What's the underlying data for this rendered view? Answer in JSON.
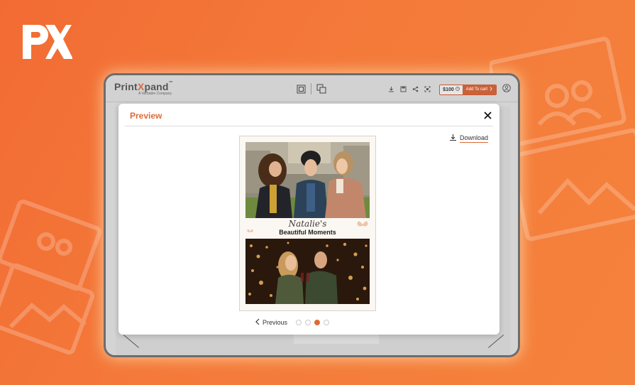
{
  "brand": {
    "logo_text": "PX",
    "accent": "#f47a3a"
  },
  "app": {
    "name_prefix": "Print",
    "name_accent": "X",
    "name_suffix": "pand",
    "trademark": "™",
    "tagline": "A Verbatim Company",
    "price": "$100",
    "add_to_cart": "Add To cart"
  },
  "modal": {
    "title": "Preview",
    "download_label": "Download",
    "caption_script": "Natalie's",
    "caption_main": "Beautiful Moments",
    "prev_label": "Previous",
    "pages": [
      {
        "state": "inactive"
      },
      {
        "state": "inactive"
      },
      {
        "state": "active"
      },
      {
        "state": "inactive"
      }
    ]
  },
  "icons": [
    "px-logo",
    "layers-icon",
    "duplicate-icon",
    "download-icon",
    "save-icon",
    "share-icon",
    "fullscreen-icon",
    "clock-icon",
    "chevron-right-icon",
    "user-icon",
    "close-icon",
    "chevron-left-icon",
    "butterfly-icon"
  ]
}
